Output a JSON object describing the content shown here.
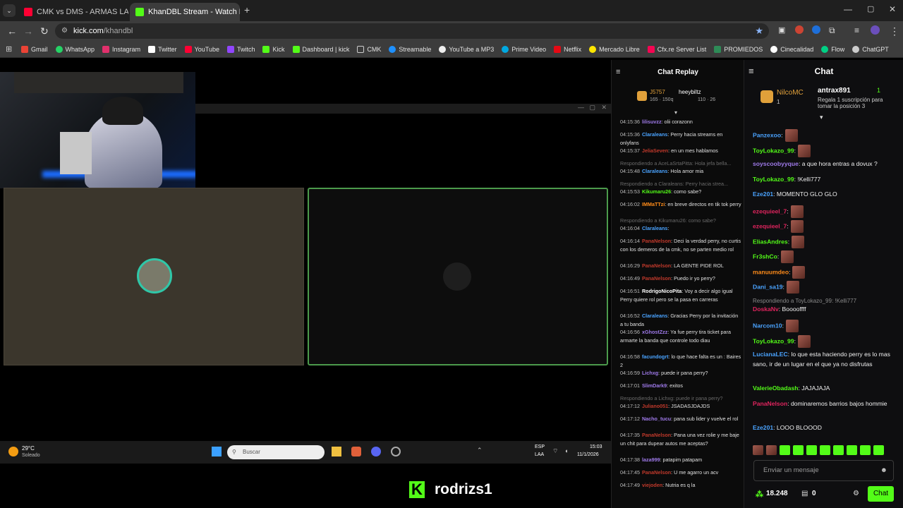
{
  "tabs": [
    {
      "title": "CMK vs DMS - ARMAS LARGAS",
      "favicon_color": "#ff0033"
    },
    {
      "title": "KhanDBL Stream - Watch Li",
      "favicon_color": "#53fc18"
    }
  ],
  "address": {
    "domain": "kick.com",
    "path": "/khandbl"
  },
  "bookmarks": [
    {
      "label": "Gmail",
      "color": "#ea4335"
    },
    {
      "label": "WhatsApp",
      "color": "#25d366"
    },
    {
      "label": "Instagram",
      "color": "#e1306c"
    },
    {
      "label": "Twitter",
      "color": "#ffffff"
    },
    {
      "label": "YouTube",
      "color": "#ff0033"
    },
    {
      "label": "Twitch",
      "color": "#9146ff"
    },
    {
      "label": "Kick",
      "color": "#53fc18"
    },
    {
      "label": "Dashboard | kick",
      "color": "#53fc18"
    },
    {
      "label": "CMK",
      "color": "#cccccc"
    },
    {
      "label": "Streamable",
      "color": "#1e90ff"
    },
    {
      "label": "YouTube a MP3",
      "color": "#eeeeee"
    },
    {
      "label": "Prime Video",
      "color": "#00a8e1"
    },
    {
      "label": "Netflix",
      "color": "#e50914"
    },
    {
      "label": "Mercado Libre",
      "color": "#ffe600"
    },
    {
      "label": "Cfx.re Server List",
      "color": "#f40552"
    },
    {
      "label": "PROMIEDOS",
      "color": "#2e8b57"
    },
    {
      "label": "Cinecalidad",
      "color": "#ffffff"
    },
    {
      "label": "Flow",
      "color": "#00d084"
    },
    {
      "label": "ChatGPT",
      "color": "#cccccc"
    }
  ],
  "taskbar": {
    "temp": "29°C",
    "weather": "Soleado",
    "search_placeholder": "Buscar",
    "lang": "ESP",
    "lang2": "LAA",
    "time": "15:03",
    "date": "11/1/2026"
  },
  "streamer_name": "rodrizs1",
  "replay": {
    "title": "Chat Replay",
    "leaders": [
      {
        "name": "J5757",
        "stats": "165 · 150q",
        "color": "#e0a03a"
      },
      {
        "name": "heeybiltz",
        "stats": "110 · 26",
        "color": "#ffffff"
      }
    ],
    "messages": [
      {
        "time": "04:15:36",
        "user": "lilisuvzz",
        "color": "#9f7aea",
        "text": ": olii corazonn"
      },
      {
        "time": "04:15:36",
        "user": "Claraleans",
        "color": "#4aa3ff",
        "text": ": Perry hacia streams en onlyfans"
      },
      {
        "time": "04:15:37",
        "user": "JeliaSeven",
        "color": "#c0392b",
        "text": ": en un mes hablamos"
      },
      {
        "reply": "Respondiendo a AceLaSrtaPitta: Hola jefa bella..."
      },
      {
        "time": "04:15:48",
        "user": "Claraleans",
        "color": "#4aa3ff",
        "text": ": Hola amor mia"
      },
      {
        "reply": "Respondiendo a Claraleans: Perry hacia strea..."
      },
      {
        "time": "04:15:53",
        "user": "Kikumaru26",
        "color": "#53fc18",
        "text": ": como sabe?"
      },
      {
        "time": "04:16:02",
        "user": "IMMaTTzi",
        "color": "#ff8c1a",
        "text": ": en breve directos en tik tok perry"
      },
      {
        "reply": "Respondiendo a Kikumaru26: como sabe?"
      },
      {
        "time": "04:16:04",
        "user": "Claraleans",
        "color": "#4aa3ff",
        "text": ":"
      },
      {
        "time": "04:16:14",
        "user": "PanaNelson",
        "color": "#c0392b",
        "text": ": Deci la verdad perry, no curtis con los demeros de la cmk, no se parten medio rol"
      },
      {
        "time": "04:16:29",
        "user": "PanaNelson",
        "color": "#c0392b",
        "text": ": LA GENTE PIDE ROL"
      },
      {
        "time": "04:16:49",
        "user": "PanaNelson",
        "color": "#c0392b",
        "text": ": Puedo ir yo perry?"
      },
      {
        "time": "04:16:51",
        "user": "RodrigoNicoPita",
        "color": "#ffffff",
        "text": ": Voy a decir algo igual Perry quiere rol pero se la pasa en carreras"
      },
      {
        "time": "04:16:52",
        "user": "Claraleans",
        "color": "#4aa3ff",
        "text": ": Gracias Perry por la invitación a tu banda"
      },
      {
        "time": "04:16:56",
        "user": "xGhostZzz",
        "color": "#9f7aea",
        "text": ": Ya fue perry tira ticket para armarte la banda que controle todo diau"
      },
      {
        "time": "04:16:58",
        "user": "facundogrt",
        "color": "#4aa3ff",
        "text": ": lo que hace falta es un : Baires 2"
      },
      {
        "time": "04:16:59",
        "user": "Lichxg",
        "color": "#9f7aea",
        "text": ": puede ir pana perry?"
      },
      {
        "time": "04:17:01",
        "user": "SlimDark9",
        "color": "#9f7aea",
        "text": ": exitos"
      },
      {
        "reply": "Respondiendo a Lichxg: puede ir pana perry?"
      },
      {
        "time": "04:17:12",
        "user": "Juliano051",
        "color": "#c0392b",
        "text": ": JSADASJDAJDS"
      },
      {
        "time": "04:17:12",
        "user": "Nacho_tucu",
        "color": "#9f7aea",
        "text": ": pana sub lider y vuelve el rol"
      },
      {
        "time": "04:17:35",
        "user": "PanaNelson",
        "color": "#c0392b",
        "text": ": Pana una vez rolie y me baje un chit para dupear autos me aceptas?"
      },
      {
        "time": "04:17:38",
        "user": "laza999",
        "color": "#9f7aea",
        "text": ": patapim patapam"
      },
      {
        "time": "04:17:45",
        "user": "PanaNelson",
        "color": "#c0392b",
        "text": ": U me agarro un acv"
      },
      {
        "time": "04:17:49",
        "user": "viejoden",
        "color": "#c0392b",
        "text": ": Nutria es q la"
      }
    ]
  },
  "chat": {
    "title": "Chat",
    "leaders": [
      {
        "name": "NilcoMC",
        "count": "1",
        "color": "#e0a03a"
      },
      {
        "name": "antrax891",
        "count": "1",
        "color": "#ffffff"
      }
    ],
    "gift_text": "Regala 1 suscripción para tomar la posición 3",
    "messages": [
      {
        "user": "Panzexoo",
        "color": "#4aa3ff",
        "text": ":",
        "emote": true
      },
      {
        "user": "ToyLokazo_99",
        "color": "#53fc18",
        "text": ":",
        "emote": true
      },
      {
        "user": "soyscoobyyque",
        "color": "#9f7aea",
        "text": ": a que hora entras a dovux ?"
      },
      {
        "user": "ToyLokazo_99",
        "color": "#53fc18",
        "text": ": !Kelli777"
      },
      {
        "user": "Eze201",
        "color": "#4aa3ff",
        "text": ": MOMENTO GLO GLO"
      },
      {
        "user": "ezequieel_7",
        "color": "#e0245e",
        "text": ":",
        "emote": true
      },
      {
        "user": "ezequieel_7",
        "color": "#e0245e",
        "text": ":",
        "emote": true
      },
      {
        "user": "EliasAndres",
        "color": "#53fc18",
        "text": ":",
        "emote": true
      },
      {
        "user": "Fr3shCo",
        "color": "#53fc18",
        "text": ":",
        "emote": true
      },
      {
        "user": "manuumdeo",
        "color": "#ff8c1a",
        "text": ":",
        "emote": true
      },
      {
        "user": "Dani_sa19",
        "color": "#4aa3ff",
        "text": ":",
        "emote": true
      },
      {
        "reply": "Respondiendo a ToyLokazo_99: !Kelli777"
      },
      {
        "user": "DoskaNv",
        "color": "#e0245e",
        "text": ": Booooffff"
      },
      {
        "user": "Narcom10",
        "color": "#4aa3ff",
        "text": ":",
        "emote": true
      },
      {
        "user": "ToyLokazo_99",
        "color": "#53fc18",
        "text": ":",
        "emote": true
      },
      {
        "user": "LucianaLEC",
        "color": "#4aa3ff",
        "text": ": lo que esta haciendo perry es lo mas sano, ir de un lugar en el que ya no disfrutas"
      },
      {
        "user": "ValerieObadash",
        "color": "#53fc18",
        "text": ": JAJAJAJA"
      },
      {
        "user": "PanaNelson",
        "color": "#e0245e",
        "text": ": dominaremos barrios bajos hommie"
      },
      {
        "user": "Eze201",
        "color": "#4aa3ff",
        "text": ": LOOO BLOOOD"
      }
    ],
    "input_placeholder": "Enviar un mensaje",
    "points": "18.248",
    "other_count": "0",
    "send_label": "Chat"
  }
}
